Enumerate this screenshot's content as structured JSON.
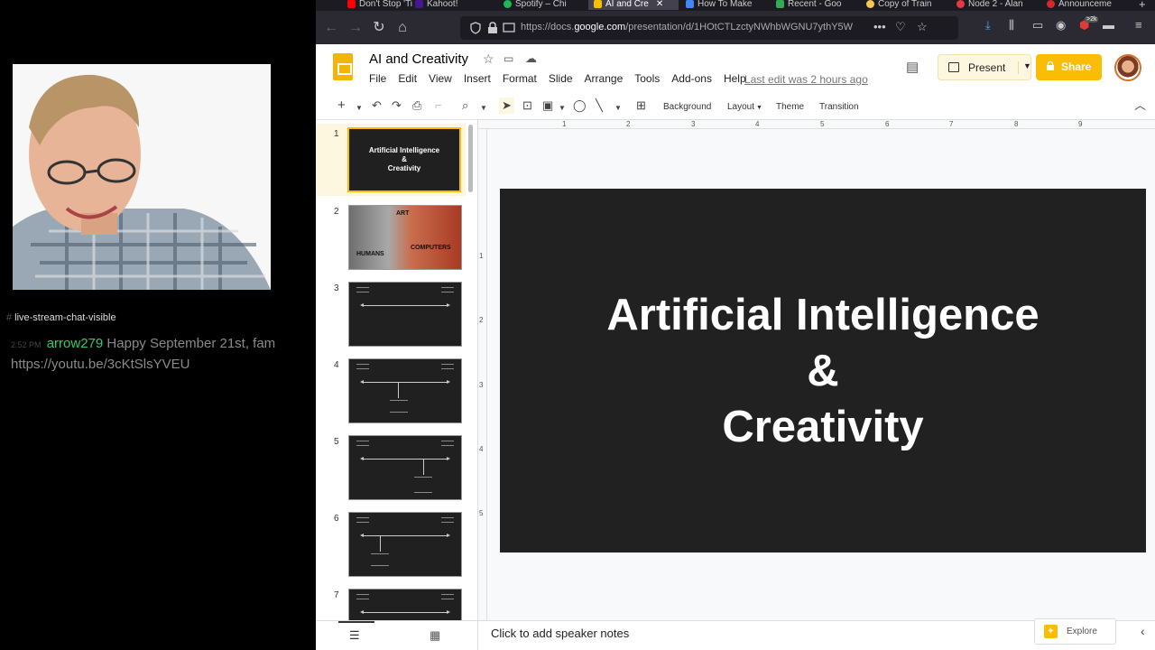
{
  "stream": {
    "chat_channel": "live-stream-chat-visible",
    "message": {
      "time": "2:52 PM",
      "user": "arrow279",
      "text": "Happy September 21st, fam https://youtu.be/3cKtSlsYVEU"
    }
  },
  "browser": {
    "tabs": [
      {
        "label": "Don't Stop 'Ti",
        "color": "#ff0000"
      },
      {
        "label": "Kahoot!",
        "color": "#46178f"
      },
      {
        "label": "Spotify – Chi",
        "color": "#1db954"
      },
      {
        "label": "AI and Cre",
        "color": "#fbbc04"
      },
      {
        "label": "How To Make",
        "color": "#4285f4"
      },
      {
        "label": "Recent - Goo",
        "color": "#34a853"
      },
      {
        "label": "Copy of Train",
        "color": "#f9c74f"
      },
      {
        "label": "Node 2 - Alan",
        "color": "#e63946"
      },
      {
        "label": "Announceme",
        "color": "#d62828"
      }
    ],
    "url": {
      "prefix": "https://docs.",
      "domain": "google.com",
      "suffix": "/presentation/d/1HOtCTLzctyNWhbWGNU7ythY5W"
    },
    "badge": ">2k"
  },
  "doc": {
    "title": "AI and Creativity",
    "menu": [
      "File",
      "Edit",
      "View",
      "Insert",
      "Format",
      "Slide",
      "Arrange",
      "Tools",
      "Add-ons",
      "Help"
    ],
    "last_edit": "Last edit was 2 hours ago",
    "present_label": "Present",
    "share_label": "Share"
  },
  "toolbar": {
    "background": "Background",
    "layout": "Layout",
    "theme": "Theme",
    "transition": "Transition"
  },
  "filmstrip": {
    "slides": [
      {
        "num": "1",
        "title": "Artificial Intelligence\n&\nCreativity"
      },
      {
        "num": "2",
        "words": [
          "ART",
          "HUMANS",
          "COMPUTERS"
        ]
      },
      {
        "num": "3"
      },
      {
        "num": "4"
      },
      {
        "num": "5"
      },
      {
        "num": "6"
      },
      {
        "num": "7"
      }
    ]
  },
  "ruler": {
    "h": [
      "1",
      "2",
      "3",
      "4",
      "5",
      "6",
      "7",
      "8",
      "9"
    ],
    "v": [
      "1",
      "2",
      "3",
      "4",
      "5"
    ]
  },
  "slide": {
    "title": "Artificial Intelligence\n&\nCreativity"
  },
  "notes": {
    "placeholder": "Click to add speaker notes"
  },
  "explore_label": "Explore"
}
